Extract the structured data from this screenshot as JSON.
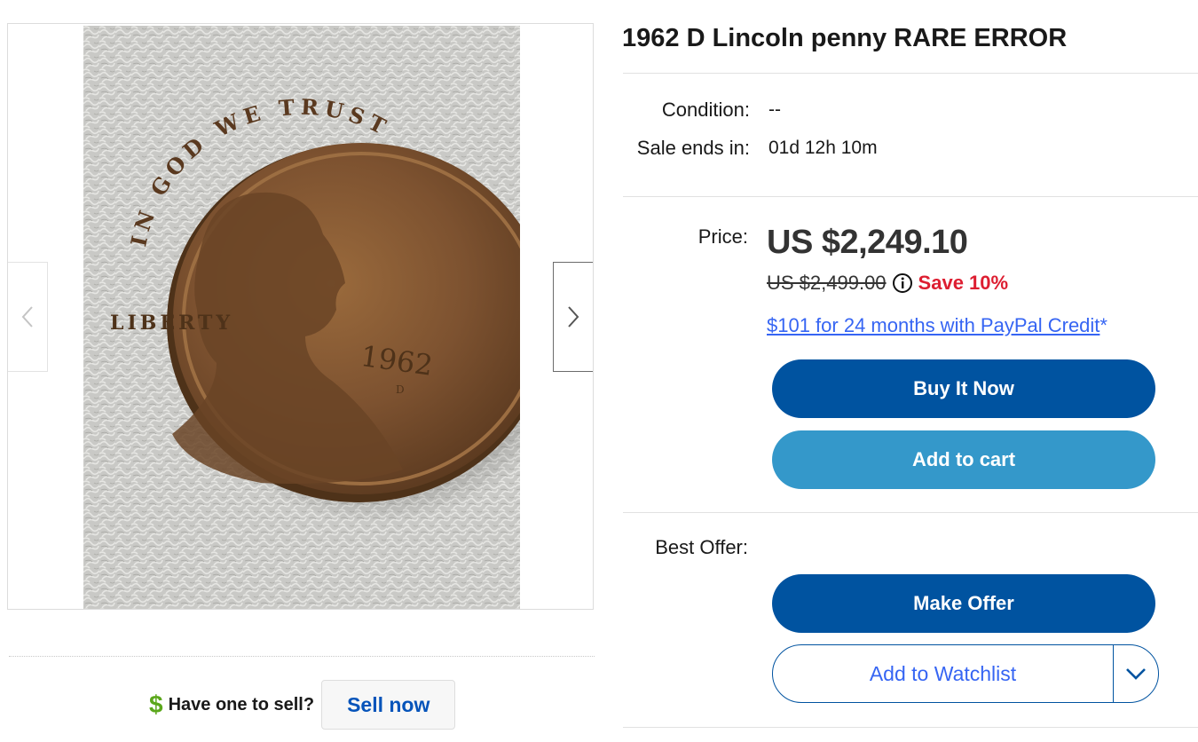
{
  "listing": {
    "title": "1962 D Lincoln penny RARE ERROR"
  },
  "gallery": {
    "image_alt": "coin-photo",
    "coin_legend_top": "IN GOD WE TRUST",
    "coin_legend_left": "LIBERTY",
    "coin_year": "1962",
    "coin_mint_mark": "D",
    "prev_icon": "chevron-left-icon",
    "next_icon": "chevron-right-icon"
  },
  "details": {
    "condition_label": "Condition:",
    "condition_value": "--",
    "sale_ends_label": "Sale ends in:",
    "sale_ends_value": "01d 12h 10m"
  },
  "pricing": {
    "price_label": "Price:",
    "price": "US $2,249.10",
    "original_price": "US $2,499.00",
    "info_icon": "info-icon",
    "save_text": "Save 10%",
    "financing_text": "$101 for 24 months with PayPal Credit",
    "financing_mark": "*"
  },
  "actions": {
    "buy_now": "Buy It Now",
    "add_to_cart": "Add to cart",
    "best_offer_label": "Best Offer:",
    "make_offer": "Make Offer",
    "add_to_watchlist": "Add to Watchlist",
    "watchlist_dropdown_icon": "chevron-down-icon"
  },
  "sell_prompt": {
    "icon": "dollar-icon",
    "icon_glyph": "$",
    "question": "Have one to sell?",
    "sell_now": "Sell now"
  },
  "colors": {
    "primary_button": "#0053a0",
    "secondary_button": "#3498ca",
    "link": "#3665f3",
    "save_red": "#dd1e31",
    "dollar_green": "#5ba71b"
  }
}
